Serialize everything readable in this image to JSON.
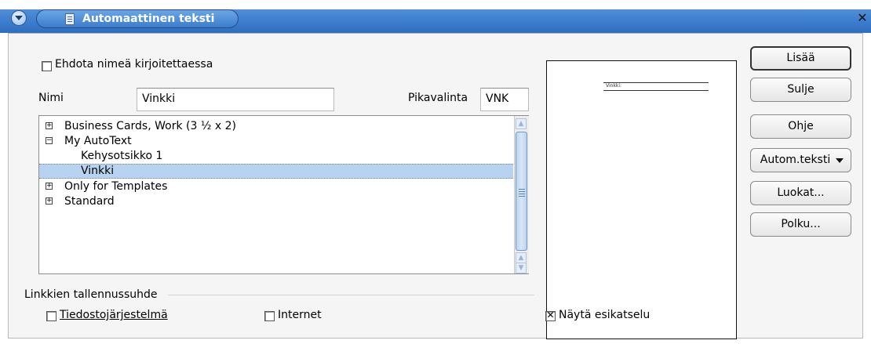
{
  "window": {
    "title": "Automaattinen teksti",
    "close_glyph": "✕"
  },
  "options": {
    "suggest_label": "Ehdota nimeä kirjoitettaessa",
    "suggest_checked": false
  },
  "name_field": {
    "label": "Nimi",
    "value": "Vinkki"
  },
  "shortcut_field": {
    "label": "Pikavalinta",
    "value": "VNK"
  },
  "tree": {
    "items": [
      {
        "label": "Business Cards, Work (3 ½ x 2)",
        "expander": "⊞",
        "level": 0,
        "selected": false
      },
      {
        "label": "My AutoText",
        "expander": "⊟",
        "level": 0,
        "selected": false
      },
      {
        "label": "Kehysotsikko 1",
        "expander": "",
        "level": 1,
        "selected": false
      },
      {
        "label": "Vinkki",
        "expander": "",
        "level": 1,
        "selected": true
      },
      {
        "label": "Only for Templates",
        "expander": "⊞",
        "level": 0,
        "selected": false
      },
      {
        "label": "Standard",
        "expander": "⊞",
        "level": 0,
        "selected": false
      }
    ]
  },
  "links": {
    "group_label": "Linkkien tallennussuhde",
    "filesystem_label": "Tiedostojärjestelmä",
    "filesystem_checked": false,
    "internet_label": "Internet",
    "internet_checked": false
  },
  "preview": {
    "show_label": "Näytä esikatselu",
    "show_checked": true,
    "sample_text": "Vinkki:"
  },
  "buttons": {
    "add": "Lisää",
    "close": "Sulje",
    "help": "Ohje",
    "autotext": "Autom.teksti",
    "categories": "Luokat...",
    "path": "Polku..."
  },
  "colors": {
    "titlebar": "#3f7fcf",
    "selection": "#b7d3ef",
    "dialog_bg": "#f5f5f5"
  }
}
